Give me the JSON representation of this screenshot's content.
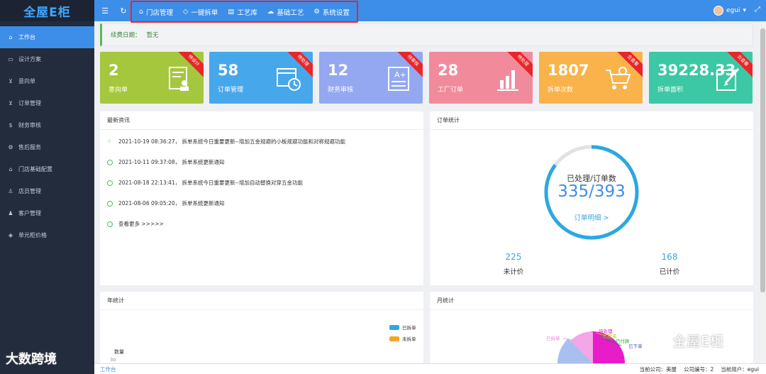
{
  "app": {
    "logo": "全屋E柜"
  },
  "sidebar": {
    "items": [
      {
        "label": "工作台",
        "icon": "home-icon",
        "glyph": "⌂"
      },
      {
        "label": "设计方案",
        "icon": "image-icon",
        "glyph": "▭"
      },
      {
        "label": "意向单",
        "icon": "cart-icon",
        "glyph": "⊻"
      },
      {
        "label": "订单管理",
        "icon": "cart-icon",
        "glyph": "⊻"
      },
      {
        "label": "财务审核",
        "icon": "dollar-icon",
        "glyph": "$"
      },
      {
        "label": "售后服务",
        "icon": "gear-icon",
        "glyph": "⚙"
      },
      {
        "label": "门店基础配置",
        "icon": "home-icon",
        "glyph": "⌂"
      },
      {
        "label": "店员管理",
        "icon": "users-icon",
        "glyph": "♙"
      },
      {
        "label": "客户管理",
        "icon": "user-icon",
        "glyph": "♟"
      },
      {
        "label": "单元柜价格",
        "icon": "cube-icon",
        "glyph": "◈"
      }
    ]
  },
  "topnav": {
    "items": [
      {
        "label": "门店管理",
        "icon": "home-icon",
        "glyph": "⌂"
      },
      {
        "label": "一键拆单",
        "icon": "shield-icon",
        "glyph": "◇"
      },
      {
        "label": "工艺库",
        "icon": "book-icon",
        "glyph": "▤"
      },
      {
        "label": "基础工艺",
        "icon": "cloud-icon",
        "glyph": "☁"
      },
      {
        "label": "系统设置",
        "icon": "gear-icon",
        "glyph": "⚙"
      }
    ]
  },
  "user": {
    "name": "egui"
  },
  "fee": {
    "label": "续费日期：",
    "value": "暂无"
  },
  "cards": [
    {
      "num": "2",
      "label": "意向单",
      "ribbon": "待设计",
      "color": "#a5c73d",
      "icon": "document-user-icon"
    },
    {
      "num": "58",
      "label": "订单管理",
      "ribbon": "待处理",
      "color": "#47a7eb",
      "icon": "calendar-clock-icon"
    },
    {
      "num": "12",
      "label": "财务审核",
      "ribbon": "待审核",
      "color": "#93a8f0",
      "icon": "grade-sheet-icon"
    },
    {
      "num": "28",
      "label": "工厂订单",
      "ribbon": "待处理",
      "color": "#f18b9c",
      "icon": "bar-chart-icon"
    },
    {
      "num": "1807",
      "label": "拆单次数",
      "ribbon": "去查看",
      "color": "#f9b34a",
      "icon": "cart-gear-icon"
    },
    {
      "num": "39228.33",
      "label": "拆单面积",
      "ribbon": "去查看",
      "color": "#3cc8a4",
      "icon": "edit-icon"
    }
  ],
  "news": {
    "title": "最新资讯",
    "items": [
      "2021-10-19 08:36:27， 拆单系统今日重要更新--增加五金规避的小板规避功能和对称规避功能",
      "2021-10-11 09:37:08， 拆单系统更新通知",
      "2021-08-18 22:13:41， 拆单系统今日重要更新--增加自动替换对穿五金功能",
      "2021-08-06 09:05:20， 拆单系统更新通知",
      "查看更多 >>>>>"
    ]
  },
  "orders": {
    "title": "订单统计",
    "caption": "已处理/订单数",
    "value": "335/393",
    "processed": 335,
    "total": 393,
    "link": "订单明细 >",
    "stats": [
      {
        "num": "225",
        "label": "未计价"
      },
      {
        "num": "168",
        "label": "已计价"
      }
    ]
  },
  "year": {
    "title": "年统计",
    "ylabel": "数量",
    "tick_top": "30",
    "legend": [
      {
        "label": "已拆单",
        "color": "#2ba8e0"
      },
      {
        "label": "未拆单",
        "color": "#f5a623"
      }
    ]
  },
  "month": {
    "title": "月统计",
    "labels": [
      "待处理",
      "已提单",
      "已付款",
      "已下单",
      "已拆单"
    ],
    "colors": [
      "#e81cc8",
      "#d4d800",
      "#2ba82b",
      "#3d5aa8",
      "#f080e0"
    ]
  },
  "footer": {
    "left": "工作台",
    "company": "当前公司：美屋",
    "code": "公司编号：2",
    "user": "当前用户：egui"
  },
  "watermarks": {
    "left": "大数跨境",
    "right": "全屋E柜"
  }
}
